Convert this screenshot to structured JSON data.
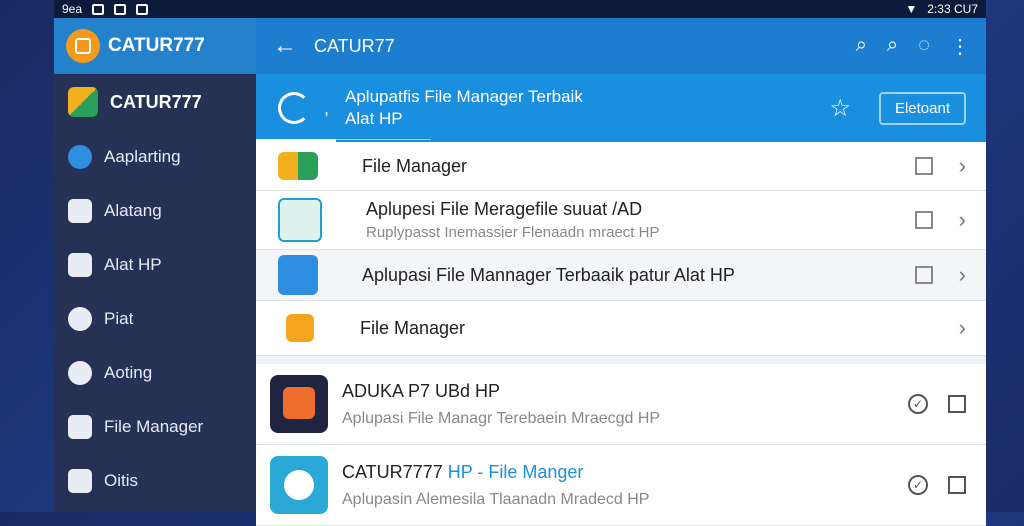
{
  "status_bar": {
    "left_text": "9ea",
    "right_text": "2:33 CU7"
  },
  "sidebar": {
    "brand_title": "CATUR777",
    "items": [
      {
        "label": "CATUR777",
        "icon": "app-logo-icon"
      },
      {
        "label": "Aaplarting",
        "icon": "clock-icon"
      },
      {
        "label": "Alatang",
        "icon": "briefcase-icon"
      },
      {
        "label": "Alat HP",
        "icon": "phone-icon"
      },
      {
        "label": "Piat",
        "icon": "sync-icon"
      },
      {
        "label": "Aoting",
        "icon": "search-icon"
      },
      {
        "label": "File Manager",
        "icon": "folder-icon"
      },
      {
        "label": "Oitis",
        "icon": "grid-icon"
      }
    ]
  },
  "appbar": {
    "title": "CATUR77",
    "back": "←",
    "icons": [
      "search-icon",
      "zoom-icon",
      "chat-icon",
      "more-icon"
    ]
  },
  "banner": {
    "line1": "Aplupatfis File Manager Terbaik",
    "line2": "Alat HP",
    "button_label": "Eletoant",
    "dot": ","
  },
  "list": [
    {
      "title": "File Manager",
      "subtitle": "",
      "checkbox": true
    },
    {
      "title": "Aplupesi File Meragefile suuat /AD",
      "subtitle": "Ruplypasst Inemassier Flenaadn mraect HP",
      "checkbox": true
    },
    {
      "title": "Aplupasi File Mannager Terbaaik patur Alat HP",
      "subtitle": "",
      "checkbox": true
    },
    {
      "title": "File Manager",
      "subtitle": "",
      "checkbox": false
    }
  ],
  "cards": [
    {
      "title_a": "ADUKA P7 UBd HP",
      "title_b": "",
      "subtitle": "Aplupasi File Managr Terebaein Mraecgd HP"
    },
    {
      "title_a": "CATUR7777 ",
      "title_b": "HP - File Manger",
      "subtitle": "Aplupasin Alemesila Tlaanadn Mradecd HP"
    }
  ],
  "colors": {
    "appbar": "#1d7ecf",
    "banner": "#1a8fe0",
    "sidebar": "#253256",
    "brand": "#2481cc",
    "accent_orange": "#f39a1e"
  }
}
